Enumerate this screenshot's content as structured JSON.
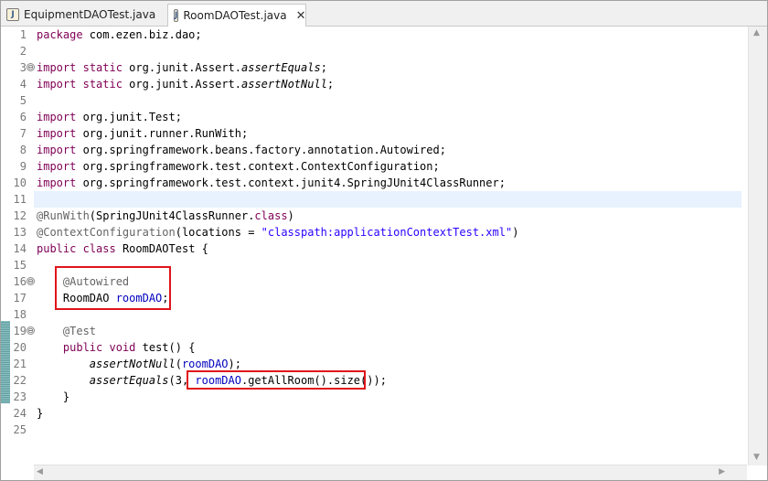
{
  "tabs": [
    {
      "label": "EquipmentDAOTest.java",
      "icon": "java-file-icon",
      "active": false
    },
    {
      "label": "RoomDAOTest.java",
      "icon": "java-file-icon",
      "active": true,
      "close": "✕"
    }
  ],
  "icon_glyph": "J",
  "fold_glyph": "⊖",
  "line_numbers": [
    "1",
    "2",
    "3",
    "4",
    "5",
    "6",
    "7",
    "8",
    "9",
    "10",
    "11",
    "12",
    "13",
    "14",
    "15",
    "16",
    "17",
    "18",
    "19",
    "20",
    "21",
    "22",
    "23",
    "24",
    "25"
  ],
  "code": {
    "l1": {
      "kw": "package",
      "rest": " com.ezen.biz.dao;"
    },
    "l3": {
      "kw1": "import",
      "kw2": "static",
      "mid": " org.junit.Assert.",
      "method": "assertEquals",
      "end": ";"
    },
    "l4": {
      "kw1": "import",
      "kw2": "static",
      "mid": " org.junit.Assert.",
      "method": "assertNotNull",
      "end": ";"
    },
    "l6": {
      "kw": "import",
      "rest": " org.junit.Test;"
    },
    "l7": {
      "kw": "import",
      "rest": " org.junit.runner.RunWith;"
    },
    "l8": {
      "kw": "import",
      "rest": " org.springframework.beans.factory.annotation.Autowired;"
    },
    "l9": {
      "kw": "import",
      "rest": " org.springframework.test.context.ContextConfiguration;"
    },
    "l10": {
      "kw": "import",
      "rest": " org.springframework.test.context.junit4.SpringJUnit4ClassRunner;"
    },
    "l12": {
      "ann": "@RunWith",
      "mid": "(SpringJUnit4ClassRunner.",
      "kw": "class",
      "end": ")"
    },
    "l13": {
      "ann": "@ContextConfiguration",
      "mid": "(locations = ",
      "str": "\"classpath:applicationContextTest.xml\"",
      "end": ")"
    },
    "l14": {
      "kw1": "public",
      "kw2": "class",
      "rest": " RoomDAOTest {"
    },
    "l16": {
      "ann": "@Autowired"
    },
    "l17": {
      "type": "RoomDAO ",
      "field": "roomDAO",
      "end": ";"
    },
    "l19": {
      "ann": "@Test"
    },
    "l20": {
      "kw1": "public",
      "kw2": "void",
      "rest": " test() {"
    },
    "l21": {
      "method": "assertNotNull",
      "open": "(",
      "field": "roomDAO",
      "end": ");"
    },
    "l22": {
      "method": "assertEquals",
      "pre": "(3, ",
      "field": "roomDAO",
      "call": ".getAllRoom().size()",
      "end": ");"
    },
    "l23": {
      "text": "}"
    },
    "l24": {
      "text": "}"
    }
  },
  "scroll": {
    "up": "▲",
    "down": "▼",
    "left": "◀",
    "right": "▶"
  }
}
